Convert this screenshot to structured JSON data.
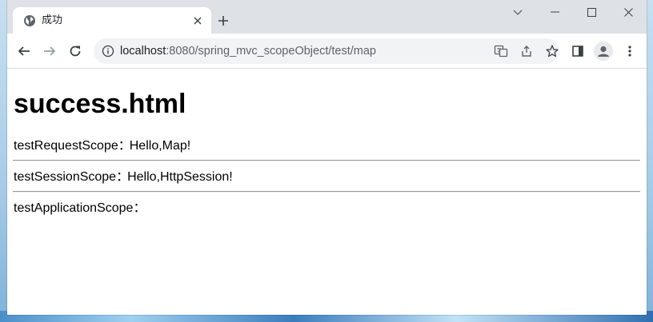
{
  "browser": {
    "tab": {
      "title": "成功",
      "favicon": "globe-icon"
    },
    "new_tab_label": "+",
    "url_host": "localhost",
    "url_rest": ":8080/spring_mvc_scopeObject/test/map",
    "toolbar_icons": [
      "back-icon",
      "forward-icon",
      "reload-icon",
      "site-info-icon",
      "translate-icon",
      "share-icon",
      "bookmark-star-icon",
      "side-panel-icon",
      "profile-avatar-icon",
      "menu-kebab-icon"
    ]
  },
  "page": {
    "heading": "success.html",
    "rows": [
      {
        "label": "testRequestScope",
        "separator": "：",
        "value": "Hello,Map!"
      },
      {
        "label": "testSessionScope",
        "separator": "：",
        "value": "Hello,HttpSession!"
      },
      {
        "label": "testApplicationScope",
        "separator": "：",
        "value": ""
      }
    ]
  },
  "colors": {
    "tabstrip_bg": "#dee1e6",
    "omnibox_bg": "#f1f3f4",
    "icon": "#5f6368"
  }
}
